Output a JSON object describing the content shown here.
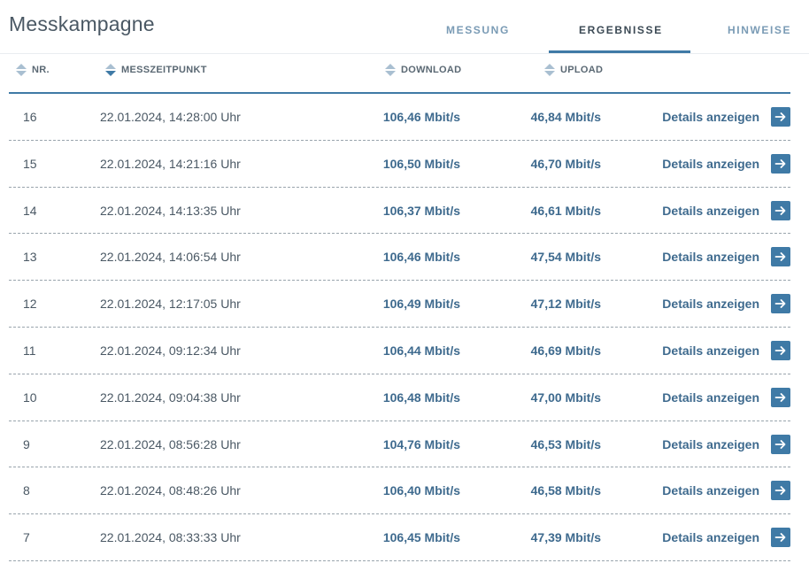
{
  "header": {
    "title": "Messkampagne",
    "tabs": [
      {
        "label": "MESSUNG"
      },
      {
        "label": "ERGEBNISSE"
      },
      {
        "label": "HINWEISE"
      }
    ],
    "active_tab": "ERGEBNISSE"
  },
  "table": {
    "columns": [
      {
        "label": "NR."
      },
      {
        "label": "MESSZEITPUNKT"
      },
      {
        "label": "DOWNLOAD"
      },
      {
        "label": "UPLOAD"
      }
    ],
    "sorted_column": "MESSZEITPUNKT",
    "details_label": "Details anzeigen",
    "rows": [
      {
        "nr": "16",
        "time": "22.01.2024, 14:28:00 Uhr",
        "download": "106,46 Mbit/s",
        "upload": "46,84 Mbit/s"
      },
      {
        "nr": "15",
        "time": "22.01.2024, 14:21:16 Uhr",
        "download": "106,50 Mbit/s",
        "upload": "46,70 Mbit/s"
      },
      {
        "nr": "14",
        "time": "22.01.2024, 14:13:35 Uhr",
        "download": "106,37 Mbit/s",
        "upload": "46,61 Mbit/s"
      },
      {
        "nr": "13",
        "time": "22.01.2024, 14:06:54 Uhr",
        "download": "106,46 Mbit/s",
        "upload": "47,54 Mbit/s"
      },
      {
        "nr": "12",
        "time": "22.01.2024, 12:17:05 Uhr",
        "download": "106,49 Mbit/s",
        "upload": "47,12 Mbit/s"
      },
      {
        "nr": "11",
        "time": "22.01.2024, 09:12:34 Uhr",
        "download": "106,44 Mbit/s",
        "upload": "46,69 Mbit/s"
      },
      {
        "nr": "10",
        "time": "22.01.2024, 09:04:38 Uhr",
        "download": "106,48 Mbit/s",
        "upload": "47,00 Mbit/s"
      },
      {
        "nr": "9",
        "time": "22.01.2024, 08:56:28 Uhr",
        "download": "104,76 Mbit/s",
        "upload": "46,53 Mbit/s"
      },
      {
        "nr": "8",
        "time": "22.01.2024, 08:48:26 Uhr",
        "download": "106,40 Mbit/s",
        "upload": "46,58 Mbit/s"
      },
      {
        "nr": "7",
        "time": "22.01.2024, 08:33:33 Uhr",
        "download": "106,45 Mbit/s",
        "upload": "47,39 Mbit/s"
      }
    ]
  },
  "colors": {
    "accent": "#3f7aa6",
    "value_text": "#3e6a8e",
    "tab_inactive": "#7a9bb5"
  },
  "icons": {
    "sort": "sort-updown-icon",
    "details": "arrow-right-icon"
  }
}
